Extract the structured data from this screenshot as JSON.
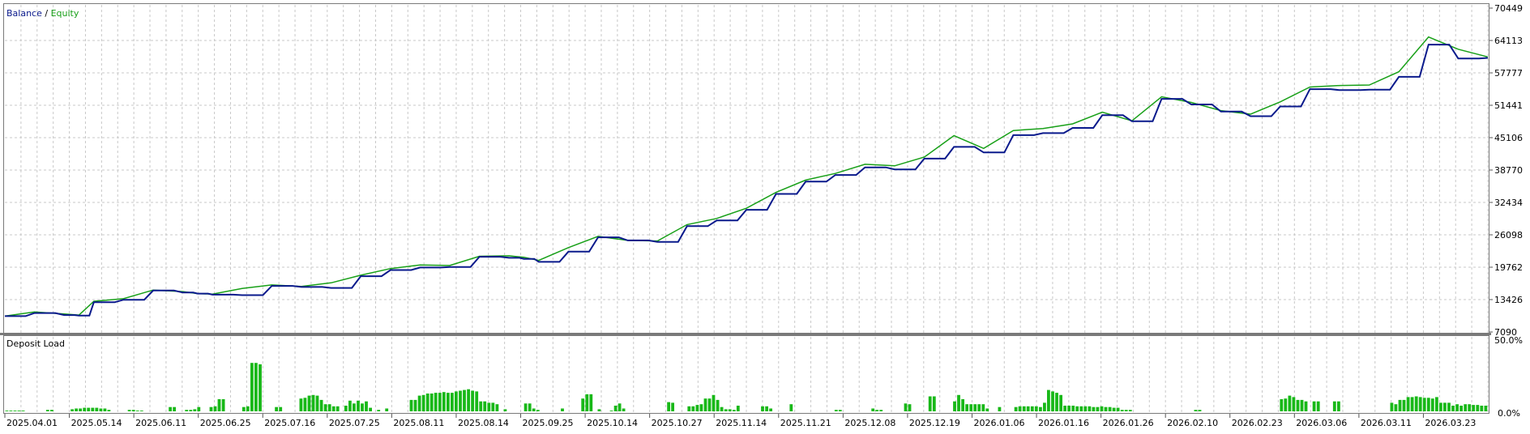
{
  "legend": {
    "balance": "Balance",
    "separator": " / ",
    "equity": "Equity"
  },
  "colors": {
    "balance": "#0a1a8c",
    "equity": "#18a018",
    "bars": "#18b818",
    "grid": "#c8c8c8",
    "frame": "#7a7a7a",
    "text": "#000000"
  },
  "chart_data": [
    {
      "type": "line",
      "title": "",
      "y_ticks": [
        7090,
        13426,
        19762,
        26098,
        32434,
        38770,
        45106,
        51441,
        57777,
        64113,
        70449
      ],
      "ylim": [
        7090,
        70449
      ],
      "x_ticks": [
        "2025.04.01",
        "2025.05.14",
        "2025.06.11",
        "2025.06.25",
        "2025.07.16",
        "2025.07.25",
        "2025.08.11",
        "2025.08.14",
        "2025.09.25",
        "2025.10.14",
        "2025.10.27",
        "2025.11.14",
        "2025.11.21",
        "2025.12.08",
        "2025.12.19",
        "2026.01.06",
        "2026.01.16",
        "2026.01.26",
        "2026.02.10",
        "2026.02.23",
        "2026.03.06",
        "2026.03.11",
        "2026.03.23"
      ],
      "x": [
        0,
        2,
        4,
        5,
        6,
        8,
        10,
        12,
        13,
        14,
        16,
        18,
        20,
        22,
        24,
        26,
        28,
        30,
        32,
        34,
        35,
        36,
        38,
        40,
        42,
        44,
        46,
        48,
        50,
        52,
        54,
        56,
        58,
        60,
        62,
        64,
        66,
        68,
        70,
        72,
        74,
        76,
        78,
        80,
        82,
        84,
        86,
        88,
        90,
        92,
        94,
        96,
        98,
        100
      ],
      "series": [
        {
          "name": "Balance",
          "values": [
            10200,
            10800,
            10400,
            10300,
            12900,
            13400,
            15200,
            14800,
            14600,
            14400,
            14300,
            16100,
            15900,
            15700,
            18000,
            19200,
            19700,
            19800,
            21800,
            21600,
            21400,
            20800,
            22800,
            25600,
            25000,
            24700,
            27800,
            28900,
            31000,
            34100,
            36500,
            37800,
            39300,
            38900,
            41000,
            43300,
            42200,
            45600,
            46000,
            47000,
            49500,
            48300,
            52700,
            51600,
            50200,
            49300,
            51200,
            54600,
            54400,
            54500,
            57000,
            63300,
            60600,
            60700
          ]
        },
        {
          "name": "Equity",
          "values": [
            10200,
            11000,
            10600,
            10400,
            13100,
            13600,
            15300,
            15000,
            14600,
            14500,
            15600,
            16300,
            16000,
            16700,
            18200,
            19500,
            20200,
            20100,
            21900,
            22000,
            21700,
            21100,
            23600,
            25800,
            25000,
            24900,
            28100,
            29300,
            31300,
            34400,
            36800,
            38100,
            39900,
            39600,
            41300,
            45500,
            43000,
            46500,
            46900,
            47800,
            50100,
            48400,
            53100,
            52000,
            50400,
            49700,
            52100,
            55000,
            55300,
            55400,
            58000,
            64800,
            62400,
            60900
          ]
        }
      ]
    },
    {
      "type": "bar",
      "title": "Deposit Load",
      "y_ticks": [
        "50.0%",
        "0.0%"
      ],
      "ylim": [
        0,
        50
      ],
      "values": [
        0.5,
        0.5,
        0.5,
        0.5,
        0.5,
        0,
        0,
        0,
        0,
        0,
        1,
        1,
        0,
        0,
        0,
        0,
        1.5,
        2,
        2,
        2.5,
        2.5,
        2.5,
        2.5,
        2,
        2,
        1,
        0,
        0,
        0,
        0,
        1,
        1,
        0.5,
        0.5,
        0,
        0,
        0,
        0,
        0,
        0,
        3,
        3,
        0,
        0,
        1,
        1,
        1.5,
        3,
        0,
        0,
        3,
        3.5,
        8.5,
        8.5,
        0,
        0,
        0,
        0,
        3,
        3.5,
        34,
        34,
        33,
        0,
        0,
        0,
        3,
        3,
        0,
        0,
        0,
        0,
        9,
        9.5,
        11,
        11.5,
        11,
        8,
        5,
        5,
        3.5,
        3.5,
        0,
        4,
        7.5,
        5.5,
        7.5,
        5.5,
        7,
        2.5,
        0,
        1,
        0,
        2,
        0,
        0,
        0,
        0,
        0,
        8,
        8,
        11,
        11.5,
        12.5,
        12.5,
        13,
        13,
        13.5,
        13,
        13,
        14,
        14.5,
        15,
        15.5,
        14.5,
        14,
        7,
        7,
        6,
        6,
        5,
        0,
        1.5,
        0,
        0,
        0,
        0,
        5.5,
        5.5,
        2,
        1,
        0,
        0,
        0,
        0,
        0,
        2,
        0,
        0,
        0,
        0,
        9,
        12,
        12,
        0,
        1.5,
        0,
        0,
        0.5,
        4,
        5.5,
        2,
        0,
        0,
        0,
        0,
        0,
        0,
        0,
        0,
        0,
        0,
        6.5,
        6,
        0,
        0,
        0,
        3.5,
        3.5,
        4.5,
        5,
        9,
        9,
        11.5,
        8,
        3,
        1.5,
        1.5,
        1,
        4,
        0,
        0,
        0,
        0,
        0,
        3.5,
        3.5,
        2,
        0,
        0,
        0,
        0,
        5,
        0,
        0,
        0,
        0,
        0,
        0,
        0,
        0,
        0,
        0,
        1,
        1,
        0,
        0,
        0,
        0,
        0,
        0,
        0,
        2,
        1,
        1,
        0,
        0,
        0,
        0,
        0,
        5.5,
        5,
        0,
        0,
        0,
        0,
        10.5,
        10.5,
        0,
        0,
        0,
        0,
        7,
        11.5,
        8.5,
        5,
        5,
        5,
        5,
        5,
        2,
        0,
        0,
        3,
        0,
        0,
        0,
        3,
        3.5,
        3.5,
        3.5,
        3.5,
        3.5,
        3,
        6,
        15,
        14,
        13,
        11.5,
        4,
        4,
        4,
        3.5,
        3.5,
        3.5,
        3.5,
        3,
        3,
        3.5,
        3,
        3,
        2.5,
        2.5,
        1,
        1,
        1,
        0,
        0,
        0,
        0,
        0,
        0,
        0,
        0,
        0,
        0,
        0,
        0,
        0,
        0,
        0,
        1,
        1,
        0,
        0,
        0,
        0,
        0,
        0,
        0,
        0,
        0,
        0,
        0,
        0,
        0,
        0,
        0,
        0,
        0,
        0,
        0,
        8.5,
        9,
        11,
        10,
        8,
        8,
        7,
        0,
        7,
        7,
        0,
        0,
        0,
        7,
        7,
        0,
        0,
        0,
        0,
        0,
        0,
        0,
        0,
        0,
        0,
        0,
        0,
        6,
        5,
        8,
        8,
        10,
        10,
        10.5,
        10,
        9.5,
        9.5,
        9,
        10,
        6,
        6,
        6,
        4,
        5,
        4,
        5,
        5,
        4.5,
        4.5,
        4,
        4
      ]
    }
  ]
}
